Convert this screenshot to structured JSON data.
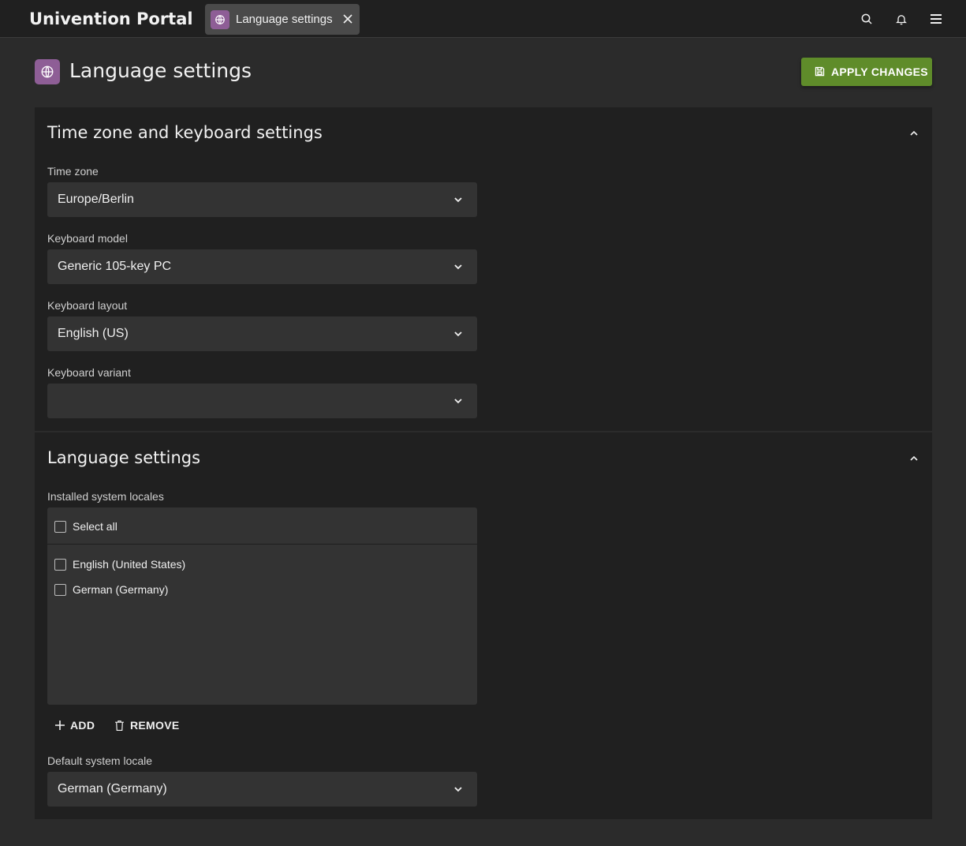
{
  "header": {
    "portal_title": "Univention Portal",
    "tab_label": "Language settings",
    "icons": [
      "globe-icon",
      "close-icon",
      "search-icon",
      "bell-icon",
      "menu-icon"
    ]
  },
  "page": {
    "title": "Language settings",
    "apply_label": "APPLY CHANGES"
  },
  "timezone_section": {
    "title": "Time zone and keyboard settings",
    "fields": [
      {
        "label": "Time zone",
        "value": "Europe/Berlin"
      },
      {
        "label": "Keyboard model",
        "value": "Generic 105-key PC"
      },
      {
        "label": "Keyboard layout",
        "value": "English (US)"
      },
      {
        "label": "Keyboard variant",
        "value": ""
      }
    ]
  },
  "language_section": {
    "title": "Language settings",
    "installed_label": "Installed system locales",
    "select_all_label": "Select all",
    "locales": [
      "English (United States)",
      "German (Germany)"
    ],
    "add_label": "ADD",
    "remove_label": "REMOVE",
    "default_label": "Default system locale",
    "default_value": "German (Germany)"
  },
  "colors": {
    "accent_green": "#5f8c2a",
    "icon_purple": "#8e5e96",
    "background": "#2b2b2b",
    "panel": "#202020",
    "input": "#333333"
  }
}
